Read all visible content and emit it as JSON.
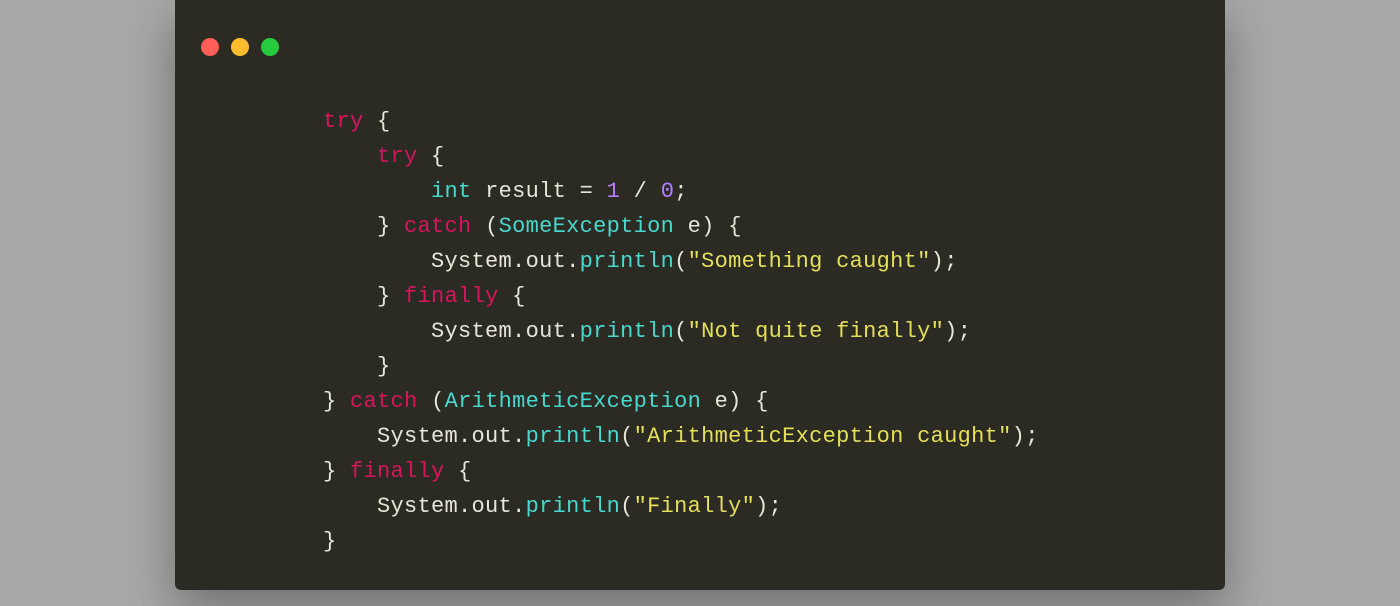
{
  "window": {
    "dot_colors": {
      "close": "#ff5f56",
      "min": "#ffbd2e",
      "max": "#27c93f"
    }
  },
  "code": {
    "indent": "    ",
    "base_indent_levels": 3,
    "tokens": {
      "try": "try",
      "catch": "catch",
      "finally": "finally",
      "int": "int",
      "result": "result",
      "eq": "=",
      "one": "1",
      "slash": "/",
      "zero": "0",
      "semi": ";",
      "lbrace": "{",
      "rbrace": "}",
      "lparen": "(",
      "rparen": ")",
      "SomeException": "SomeException",
      "ArithmeticException": "ArithmeticException",
      "e": "e",
      "System": "System",
      "dot": ".",
      "out": "out",
      "println": "println",
      "str_something": "\"Something caught\"",
      "str_notquite": "\"Not quite finally\"",
      "str_arith": "\"ArithmeticException caught\"",
      "str_finally": "\"Finally\""
    }
  }
}
